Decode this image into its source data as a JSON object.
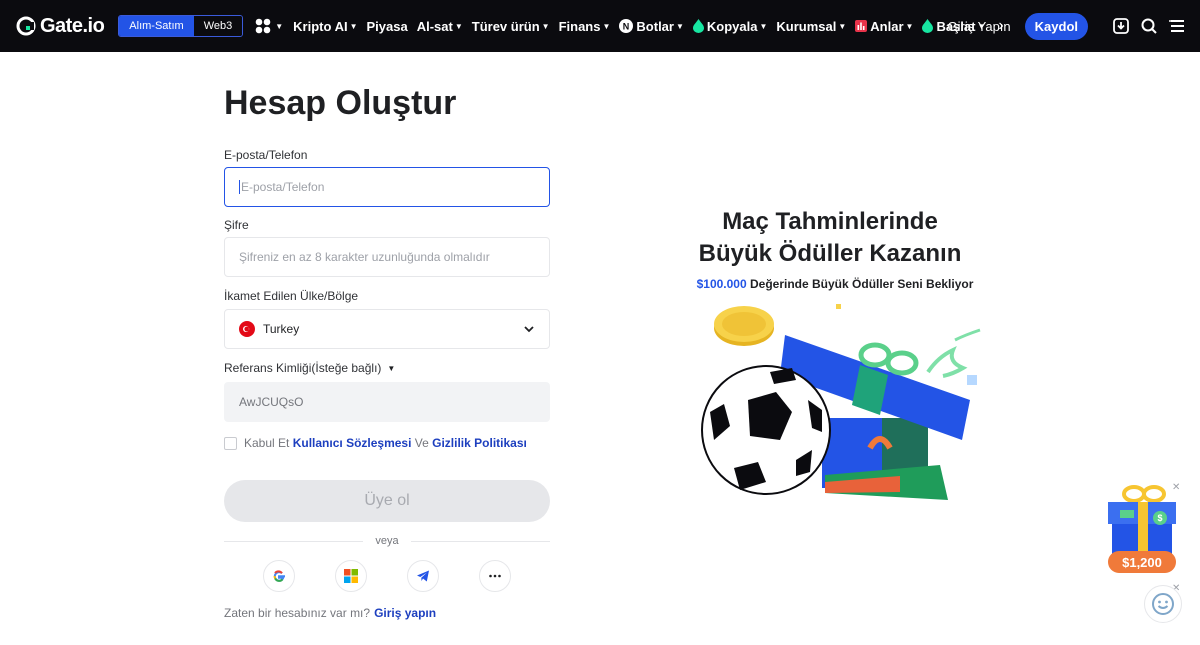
{
  "nav": {
    "brand": "Gate.io",
    "mode_spot": "Alım-Satım",
    "mode_web3": "Web3",
    "items": [
      {
        "label": "Kripto AI"
      },
      {
        "label": "Piyasa"
      },
      {
        "label": "Al-sat"
      },
      {
        "label": "Türev ürün"
      },
      {
        "label": "Finans"
      },
      {
        "label": "Botlar"
      },
      {
        "label": "Kopyala"
      },
      {
        "label": "Kurumsal"
      },
      {
        "label": "Anlar"
      },
      {
        "label": "Başlat"
      }
    ],
    "login": "Giriş Yapın",
    "signup": "Kaydol"
  },
  "form": {
    "title": "Hesap Oluştur",
    "email_label": "E-posta/Telefon",
    "email_placeholder": "E-posta/Telefon",
    "password_label": "Şifre",
    "password_placeholder": "Şifreniz en az 8 karakter uzunluğunda olmalıdır",
    "country_label": "İkamet Edilen Ülke/Bölge",
    "country_value": "Turkey",
    "referral_label": "Referans Kimliği(İsteğe bağlı)",
    "referral_value": "AwJCUQsO",
    "terms_prefix": "Kabul Et",
    "terms_link": "Kullanıcı Sözleşmesi",
    "terms_and": "Ve",
    "privacy_link": "Gizlilik Politikası",
    "submit": "Üye ol",
    "or": "veya",
    "have_account": "Zaten bir hesabınız var mı?",
    "login_link": "Giriş yapın"
  },
  "promo": {
    "title_line1": "Maç Tahminlerinde",
    "title_line2": "Büyük Ödüller Kazanın",
    "amount": "$100.000",
    "subtitle": "Değerinde Büyük Ödüller Seni Bekliyor"
  },
  "floating": {
    "gift_amount": "$1,200"
  },
  "colors": {
    "accent": "#2354e6",
    "nav_bg": "#0b0b0f",
    "link": "#1d3fbf",
    "gift_orange": "#f07a3a"
  }
}
